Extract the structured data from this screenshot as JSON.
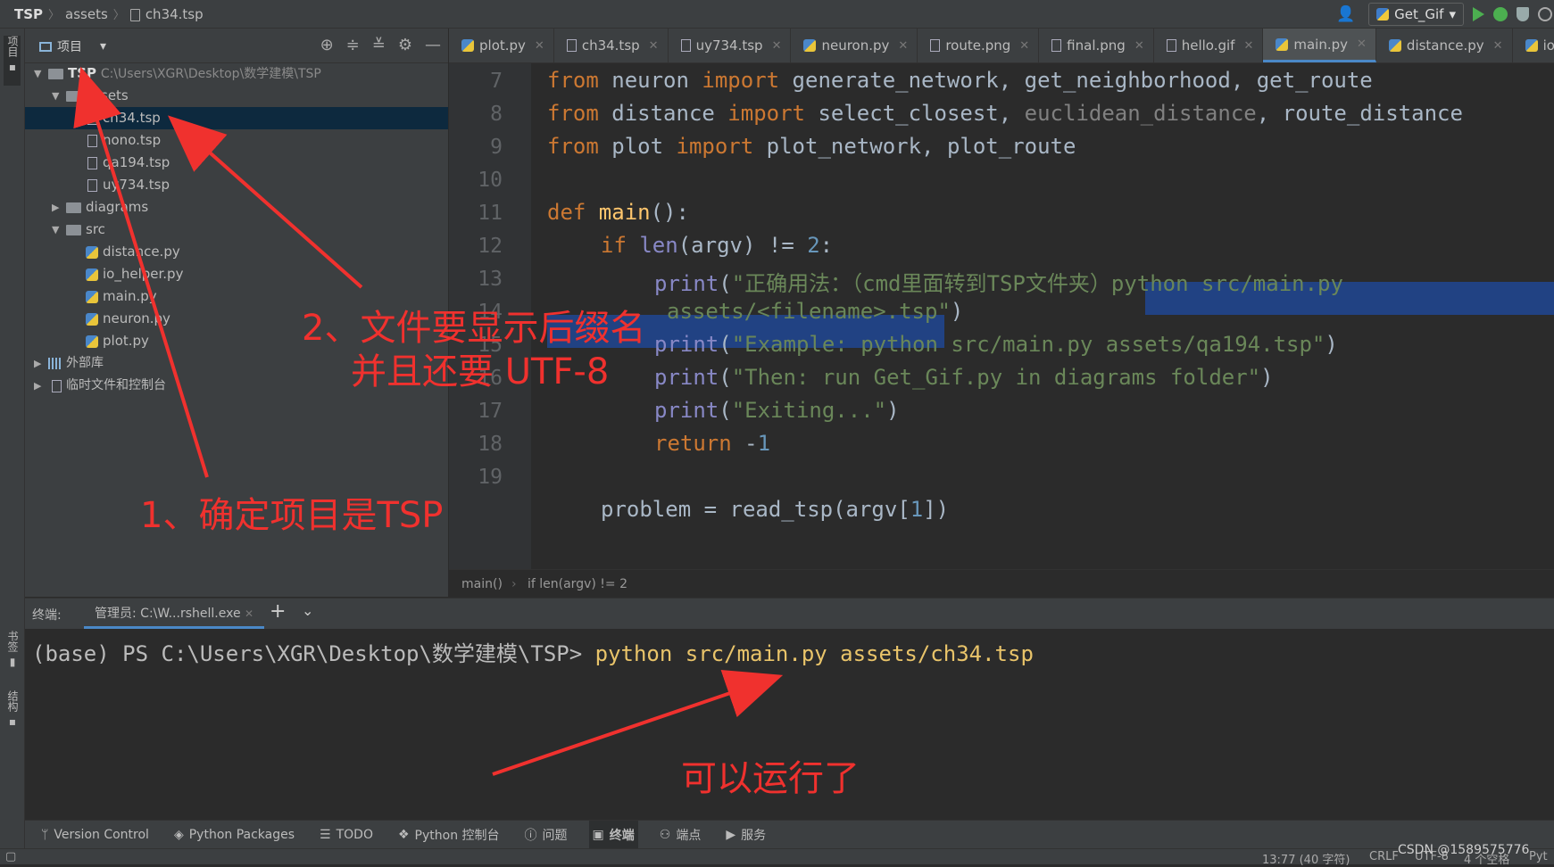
{
  "navbar": {
    "crumbs": [
      "TSP",
      "assets",
      "ch34.tsp"
    ],
    "run_config": "Get_Gif"
  },
  "left_strip": {
    "project_tab": "项目",
    "bookmark_tab": "书签",
    "structure_tab": "结构"
  },
  "project": {
    "title": "项目",
    "root_name": "TSP",
    "root_path": "C:\\Users\\XGR\\Desktop\\数学建模\\TSP",
    "assets": "assets",
    "files_assets": [
      "ch34.tsp",
      "nono.tsp",
      "qa194.tsp",
      "uy734.tsp"
    ],
    "diagrams": "diagrams",
    "src": "src",
    "files_src": [
      "distance.py",
      "io_helper.py",
      "main.py",
      "neuron.py",
      "plot.py"
    ],
    "external_libs": "外部库",
    "scratches": "临时文件和控制台"
  },
  "tabs": [
    "plot.py",
    "ch34.tsp",
    "uy734.tsp",
    "neuron.py",
    "route.png",
    "final.png",
    "hello.gif",
    "main.py",
    "distance.py",
    "io_he"
  ],
  "editor": {
    "line_numbers": [
      "7",
      "8",
      "9",
      "10",
      "11",
      "12",
      "13",
      "14",
      "15",
      "16",
      "17",
      "18",
      "19"
    ],
    "l7": {
      "a": "from",
      "b": " neuron ",
      "c": "import",
      "d": " generate_network, get_neighborhood, get_route"
    },
    "l8": {
      "a": "from",
      "b": " distance ",
      "c": "import",
      "d": " select_closest, ",
      "e": "euclidean_distance",
      "f": ", route_distance"
    },
    "l9": {
      "a": "from",
      "b": " plot ",
      "c": "import",
      "d": " plot_network, plot_route"
    },
    "l11": {
      "a": "def",
      "b": " main",
      "c": "():"
    },
    "l12": {
      "a": "if",
      "b": " ",
      "c": "len",
      "d": "(argv) != ",
      "e": "2",
      "f": ":"
    },
    "l13": {
      "a": "print",
      "b": "(",
      "c": "\"正确用法：（cmd里面转到TSP文件夹）",
      "d": "python src/main.py "
    },
    "l14": {
      "a": "assets/<filename>.tsp",
      "b": "\"",
      "c": ")"
    },
    "l15": {
      "a": "print",
      "b": "(",
      "c": "\"Example: python src/main.py assets/qa194.tsp\"",
      "d": ")"
    },
    "l16": {
      "a": "print",
      "b": "(",
      "c": "\"Then: run Get_Gif.py in diagrams folder\"",
      "d": ")"
    },
    "l17": {
      "a": "print",
      "b": "(",
      "c": "\"Exiting...\"",
      "d": ")"
    },
    "l18": {
      "a": "return",
      "b": " -",
      "c": "1"
    },
    "l19": {
      "a": "problem = read_tsp(argv[",
      "b": "1",
      "c": "])"
    }
  },
  "breadcrumb_bar": {
    "a": "main()",
    "b": "if len(argv) != 2"
  },
  "terminal": {
    "label": "终端:",
    "tab": "管理员: C:\\W...rshell.exe",
    "prompt": "(base) PS C:\\Users\\XGR\\Desktop\\数学建模\\TSP> ",
    "command": "python src/main.py assets/ch34.tsp"
  },
  "toolbar": [
    "Version Control",
    "Python Packages",
    "TODO",
    "Python 控制台",
    "问题",
    "终端",
    "端点",
    "服务"
  ],
  "status": {
    "pos": "13:77 (40 字符)",
    "crlf": "CRLF",
    "enc": "UTF-8",
    "indent": "4 个空格",
    "interp": "Pyt",
    "watermark": "CSDN @1589575776"
  },
  "annotations": {
    "note1": "1、确定项目是TSP",
    "note2a": "2、文件要显示后缀名",
    "note2b": "并且还要 UTF-8",
    "note3": "可以运行了"
  },
  "colors": {
    "annotation": "#f0312e",
    "selection": "#214283",
    "keyword": "#cc7832",
    "string": "#6a8759"
  }
}
